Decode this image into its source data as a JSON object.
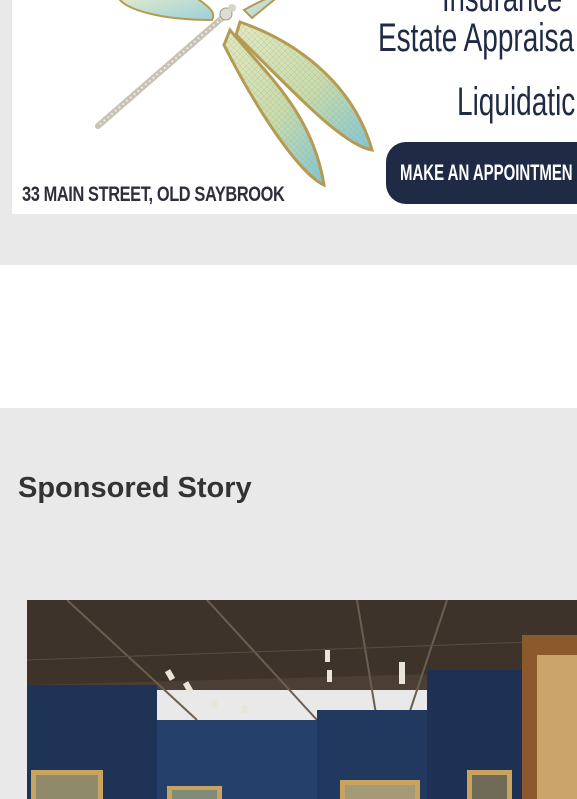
{
  "ad": {
    "address": "33 MAIN STREET, OLD SAYBROOK",
    "line_1": "Insurance",
    "line_2": "Estate Appraisa",
    "line_3": "Liquidatic",
    "cta_label": "MAKE AN APPOINTMEN",
    "colors": {
      "navy": "#1f2a44",
      "band": "#e9e9e9"
    }
  },
  "sponsored": {
    "heading": "Sponsored Story",
    "image_icon": "gallery-photo"
  }
}
